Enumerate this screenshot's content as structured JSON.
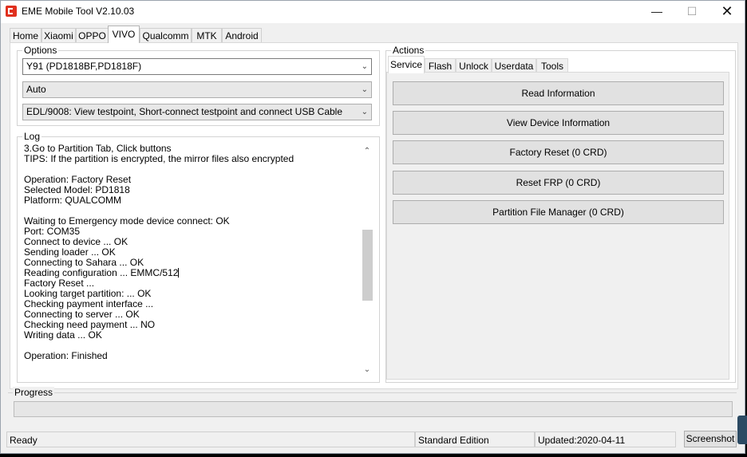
{
  "window": {
    "title": "EME Mobile Tool V2.10.03"
  },
  "tabs": [
    "Home",
    "Xiaomi",
    "OPPO",
    "VIVO",
    "Qualcomm",
    "MTK",
    "Android"
  ],
  "options": {
    "label": "Options",
    "model": "Y91 (PD1818BF,PD1818F)",
    "mode": "Auto",
    "connection": "EDL/9008: View testpoint, Short-connect testpoint and connect USB Cable"
  },
  "log": {
    "label": "Log",
    "lines": [
      "3.Go to Partition Tab, Click buttons",
      "TIPS: If the partition is encrypted, the mirror files also encrypted",
      "",
      "Operation: Factory Reset",
      "Selected Model: PD1818",
      "Platform: QUALCOMM",
      "",
      "Waiting to Emergency mode device connect: OK",
      "Port: COM35",
      "Connect to device ... OK",
      "Sending loader ... OK",
      "Connecting to Sahara ... OK",
      "Reading configuration ... EMMC/512",
      "Factory Reset ...",
      "Looking target partition: ... OK",
      "Checking payment interface ...",
      "Connecting to server ... OK",
      "Checking need payment ... NO",
      "Writing data ... OK",
      "",
      "Operation: Finished"
    ]
  },
  "actions": {
    "label": "Actions",
    "tabs": [
      "Service",
      "Flash",
      "Unlock",
      "Userdata",
      "Tools"
    ],
    "buttons": [
      "Read Information",
      "View Device Information",
      "Factory Reset (0 CRD)",
      "Reset FRP (0 CRD)",
      "Partition File Manager (0 CRD)"
    ]
  },
  "progress": {
    "label": "Progress",
    "value": 0
  },
  "status": {
    "state": "Ready",
    "edition": "Standard Edition",
    "updated": "Updated:2020-04-11",
    "screenshot_label": "Screenshot"
  },
  "colors": {
    "brand": "#e0301e",
    "progress_fill": "#06b025"
  }
}
